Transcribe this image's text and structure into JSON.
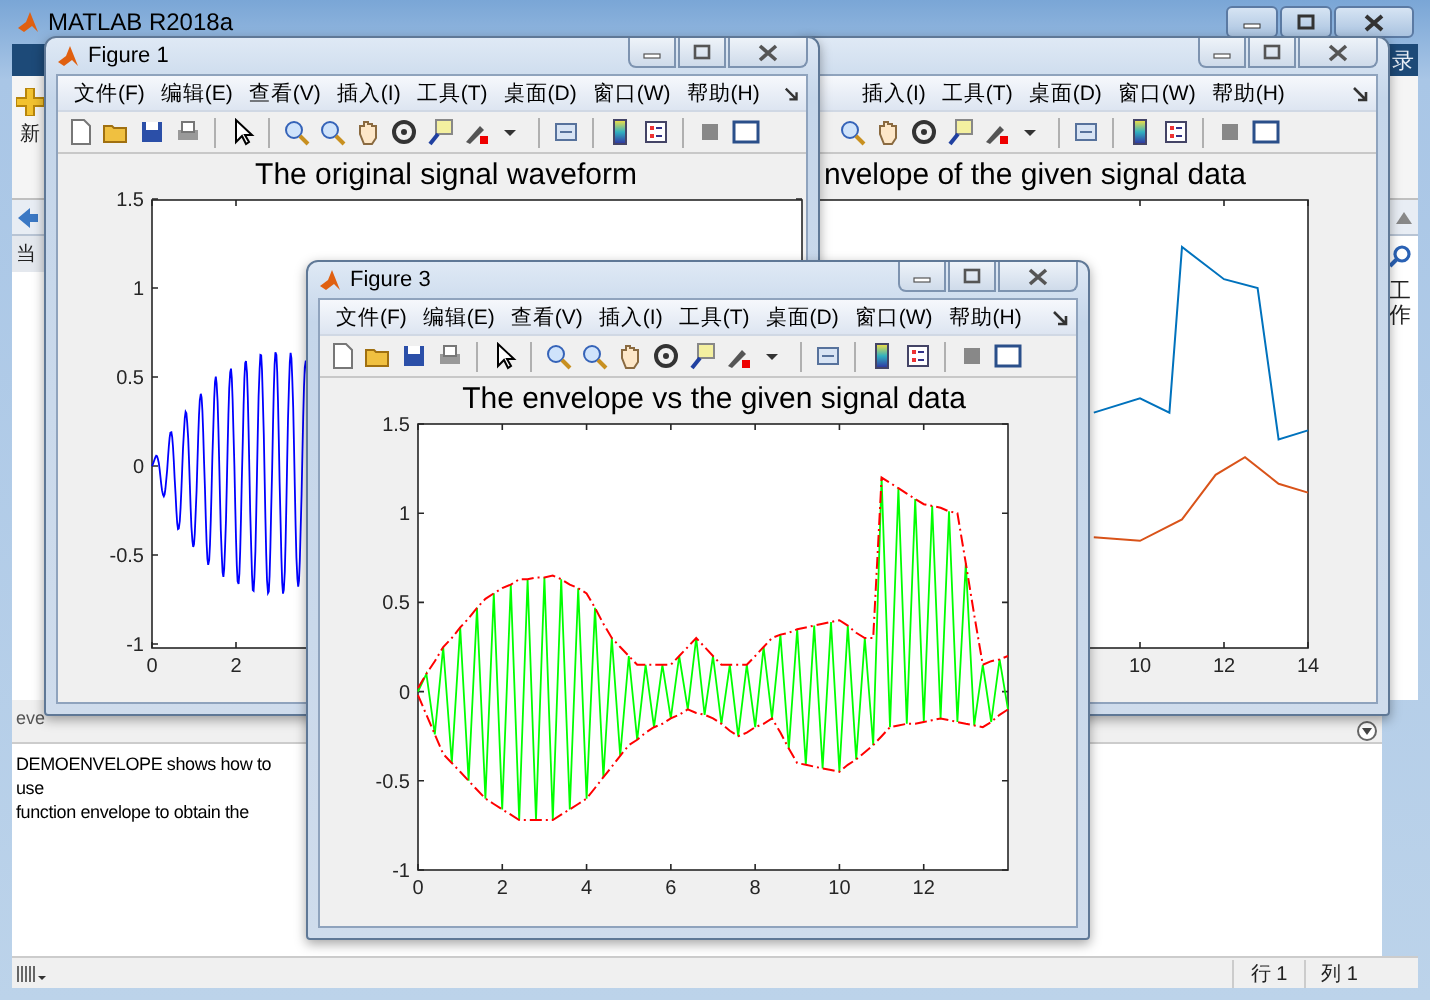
{
  "main_window": {
    "title": "MATLAB R2018a",
    "toolstrip_tab_fragment": "录",
    "new_button_fragment": "新",
    "current_folder_fragment": "当",
    "workspace_fragment": "工作",
    "command_window": {
      "tab_fragment": "eve",
      "lines": [
        "DEMOENVELOPE shows how to use",
        "function envelope to obtain the"
      ]
    },
    "status_bar": {
      "row": "行 1",
      "column": "列 1"
    }
  },
  "figures": [
    {
      "kind": "signal",
      "title": "Figure 1",
      "menu": [
        "文件(F)",
        "编辑(E)",
        "查看(V)",
        "插入(I)",
        "工具(T)",
        "桌面(D)",
        "窗口(W)",
        "帮助(H)"
      ],
      "plot_title": "The original signal waveform",
      "yticks": [
        "1.5",
        "1",
        "0.5",
        "0",
        "-0.5",
        "-1"
      ],
      "xticks": [
        "0",
        "2"
      ]
    },
    {
      "kind": "envelopes",
      "menu": [
        "插入(I)",
        "工具(T)",
        "桌面(D)",
        "窗口(W)",
        "帮助(H)"
      ],
      "plot_title": "nvelope of the given signal data",
      "xticks": [
        "10",
        "12",
        "14"
      ]
    },
    {
      "kind": "overlay",
      "title": "Figure 3",
      "menu": [
        "文件(F)",
        "编辑(E)",
        "查看(V)",
        "插入(I)",
        "工具(T)",
        "桌面(D)",
        "窗口(W)",
        "帮助(H)"
      ],
      "chart_data": {
        "type": "line",
        "title": "The envelope vs the given signal data",
        "xlim": [
          0,
          14
        ],
        "ylim": [
          -1,
          1.5
        ],
        "xticks": [
          0,
          2,
          4,
          6,
          8,
          10,
          12
        ],
        "yticks": [
          1.5,
          1,
          0.5,
          0,
          -0.5,
          -1
        ],
        "x": [
          0,
          0.2,
          0.4,
          0.6,
          0.8,
          1,
          1.2,
          1.4,
          1.6,
          1.8,
          2,
          2.2,
          2.4,
          2.6,
          2.8,
          3,
          3.2,
          3.4,
          3.6,
          3.8,
          4,
          4.2,
          4.4,
          4.6,
          4.8,
          5,
          5.2,
          5.4,
          5.6,
          5.8,
          6,
          6.2,
          6.4,
          6.6,
          6.8,
          7,
          7.2,
          7.4,
          7.6,
          7.8,
          8,
          8.2,
          8.4,
          8.6,
          8.8,
          9,
          9.2,
          9.4,
          9.6,
          9.8,
          10,
          10.2,
          10.4,
          10.6,
          10.8,
          11,
          11.2,
          11.4,
          11.6,
          11.8,
          12,
          12.2,
          12.4,
          12.6,
          12.8,
          13,
          13.2,
          13.4,
          13.6,
          13.8,
          14
        ],
        "series": [
          {
            "color": "#00ff00",
            "line_style": "solid",
            "values": [
              0,
              0.1,
              -0.24,
              0.25,
              -0.4,
              0.36,
              -0.5,
              0.47,
              -0.6,
              0.55,
              -0.66,
              0.6,
              -0.72,
              0.63,
              -0.72,
              0.64,
              -0.72,
              0.63,
              -0.66,
              0.58,
              -0.6,
              0.47,
              -0.48,
              0.3,
              -0.36,
              0.2,
              -0.27,
              0.15,
              -0.2,
              0.15,
              -0.15,
              0.2,
              -0.1,
              0.3,
              -0.13,
              0.2,
              -0.18,
              0.15,
              -0.25,
              0.15,
              -0.2,
              0.25,
              -0.15,
              0.32,
              -0.32,
              0.35,
              -0.41,
              0.37,
              -0.43,
              0.39,
              -0.45,
              0.37,
              -0.38,
              0.3,
              -0.3,
              1.2,
              -0.2,
              1.14,
              -0.18,
              1.08,
              -0.17,
              1.04,
              -0.15,
              1.01,
              -0.17,
              0.72,
              -0.19,
              0.15,
              -0.17,
              0.18,
              -0.1
            ]
          },
          {
            "color": "#ff0000",
            "line_style": "dashdot",
            "values": [
              0.02,
              0.1,
              0.17,
              0.25,
              0.3,
              0.36,
              0.41,
              0.47,
              0.52,
              0.55,
              0.58,
              0.6,
              0.63,
              0.63,
              0.64,
              0.64,
              0.65,
              0.63,
              0.6,
              0.58,
              0.55,
              0.47,
              0.38,
              0.3,
              0.25,
              0.2,
              0.15,
              0.15,
              0.15,
              0.15,
              0.15,
              0.2,
              0.25,
              0.3,
              0.25,
              0.2,
              0.15,
              0.15,
              0.15,
              0.15,
              0.2,
              0.25,
              0.3,
              0.32,
              0.33,
              0.35,
              0.36,
              0.37,
              0.38,
              0.39,
              0.4,
              0.37,
              0.33,
              0.3,
              0.3,
              1.2,
              1.17,
              1.14,
              1.11,
              1.08,
              1.05,
              1.04,
              1.03,
              1.01,
              1.0,
              0.72,
              0.43,
              0.15,
              0.17,
              0.18,
              0.2
            ]
          },
          {
            "color": "#ff0000",
            "line_style": "dashdot",
            "values": [
              -0.02,
              -0.13,
              -0.24,
              -0.35,
              -0.4,
              -0.45,
              -0.5,
              -0.55,
              -0.6,
              -0.63,
              -0.66,
              -0.69,
              -0.72,
              -0.72,
              -0.72,
              -0.72,
              -0.72,
              -0.69,
              -0.66,
              -0.63,
              -0.6,
              -0.54,
              -0.48,
              -0.42,
              -0.36,
              -0.3,
              -0.27,
              -0.23,
              -0.2,
              -0.18,
              -0.15,
              -0.13,
              -0.1,
              -0.12,
              -0.13,
              -0.15,
              -0.18,
              -0.22,
              -0.25,
              -0.23,
              -0.2,
              -0.18,
              -0.15,
              -0.23,
              -0.32,
              -0.4,
              -0.41,
              -0.42,
              -0.43,
              -0.44,
              -0.45,
              -0.41,
              -0.38,
              -0.34,
              -0.3,
              -0.25,
              -0.2,
              -0.19,
              -0.18,
              -0.18,
              -0.17,
              -0.16,
              -0.15,
              -0.16,
              -0.17,
              -0.18,
              -0.19,
              -0.2,
              -0.17,
              -0.13,
              -0.1
            ]
          }
        ]
      }
    }
  ]
}
